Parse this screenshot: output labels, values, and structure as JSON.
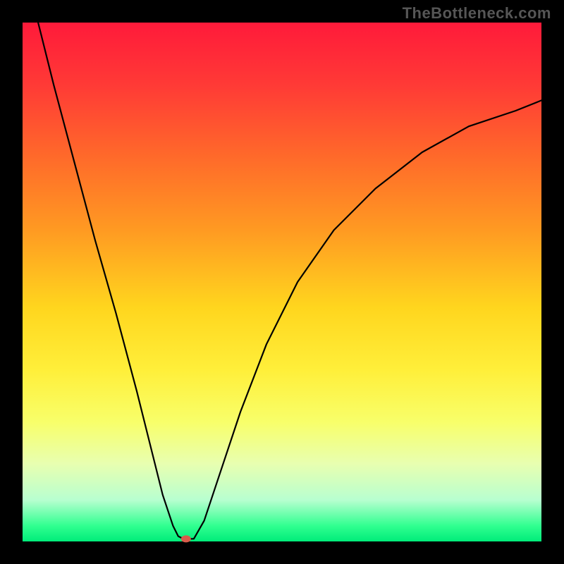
{
  "attribution": "TheBottleneck.com",
  "chart_data": {
    "type": "line",
    "title": "",
    "xlabel": "",
    "ylabel": "",
    "xlim": [
      0,
      100
    ],
    "ylim": [
      0,
      100
    ],
    "grid": false,
    "legend": false,
    "series": [
      {
        "name": "curve",
        "color": "#000000",
        "x": [
          3,
          6,
          10,
          14,
          18,
          22,
          25,
          27,
          29,
          30,
          31,
          32,
          33,
          35,
          38,
          42,
          47,
          53,
          60,
          68,
          77,
          86,
          95,
          100
        ],
        "y": [
          100,
          88,
          73,
          58,
          44,
          29,
          17,
          9,
          3,
          1,
          0.5,
          0.5,
          0.5,
          4,
          13,
          25,
          38,
          50,
          60,
          68,
          75,
          80,
          83,
          85
        ]
      }
    ],
    "marker": {
      "name": "min-point",
      "x": 31.5,
      "y": 0.5,
      "color": "#d95b4a",
      "rx": 7,
      "ry": 5
    }
  }
}
